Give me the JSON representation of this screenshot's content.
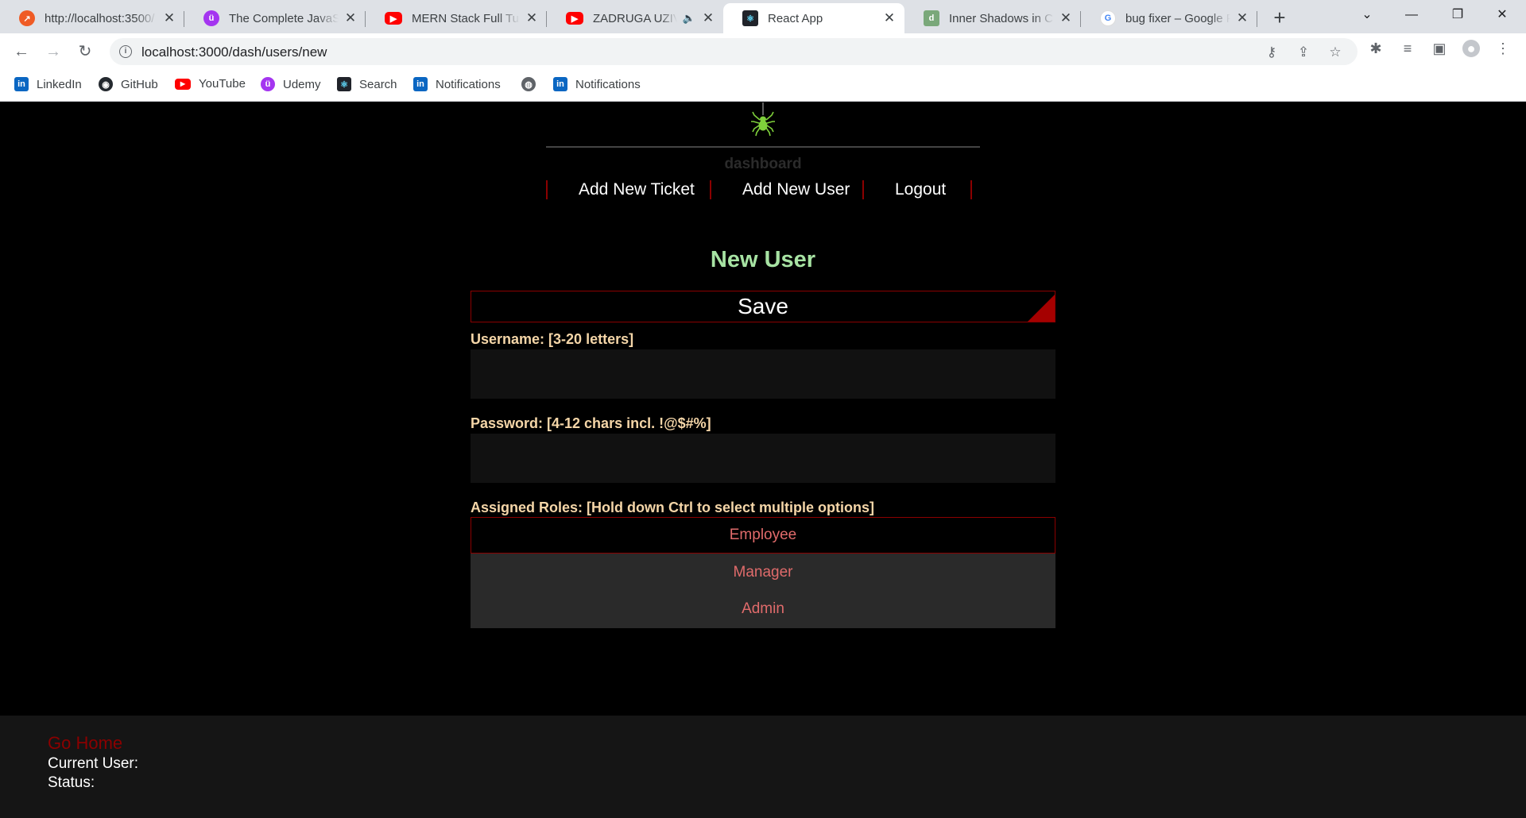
{
  "browser": {
    "tabs": [
      {
        "title": "http://localhost:3500/",
        "favicon": "postman-icon",
        "active": false
      },
      {
        "title": "The Complete JavaScript",
        "favicon": "udemy-icon",
        "active": false
      },
      {
        "title": "MERN Stack Full Tutorial",
        "favicon": "youtube-icon",
        "active": false
      },
      {
        "title": "ZADRUGA UZIVO",
        "favicon": "youtube-icon",
        "active": false,
        "audio": true
      },
      {
        "title": "React App",
        "favicon": "react-icon",
        "active": true
      },
      {
        "title": "Inner Shadows in CSS",
        "favicon": "d-icon",
        "active": false
      },
      {
        "title": "bug fixer – Google Pretraga",
        "favicon": "google-icon",
        "active": false
      }
    ],
    "new_tab_label": "+",
    "url": "localhost:3000/dash/users/new",
    "bookmarks": [
      {
        "label": "LinkedIn",
        "icon": "linkedin-icon"
      },
      {
        "label": "GitHub",
        "icon": "github-icon"
      },
      {
        "label": "YouTube",
        "icon": "youtube-icon"
      },
      {
        "label": "Udemy",
        "icon": "udemy-icon"
      },
      {
        "label": "Search",
        "icon": "react-icon"
      },
      {
        "label": "Notifications",
        "icon": "linkedin-icon"
      },
      {
        "label": "",
        "icon": "globe-icon"
      },
      {
        "label": "Notifications",
        "icon": "linkedin-icon"
      }
    ]
  },
  "app": {
    "header": {
      "dashboard_label": "dashboard",
      "nav": [
        "Add New Ticket",
        "Add New User",
        "Logout"
      ]
    },
    "form": {
      "title": "New User",
      "save_label": "Save",
      "username_label": "Username: [3-20 letters]",
      "username_value": "",
      "password_label": "Password: [4-12 chars incl. !@$#%]",
      "password_value": "",
      "roles_label": "Assigned Roles: [Hold down Ctrl to select multiple options]",
      "roles": [
        "Employee",
        "Manager",
        "Admin"
      ],
      "selected_role": "Employee"
    },
    "footer": {
      "go_home": "Go Home",
      "current_user_label": "Current User:",
      "status_label": "Status:"
    }
  },
  "colors": {
    "accent_red": "#8b0000",
    "title_green": "#a7e3a3",
    "label_peach": "#f5d6a8",
    "role_text": "#e06b6b",
    "spider_green": "#7fd13b"
  }
}
